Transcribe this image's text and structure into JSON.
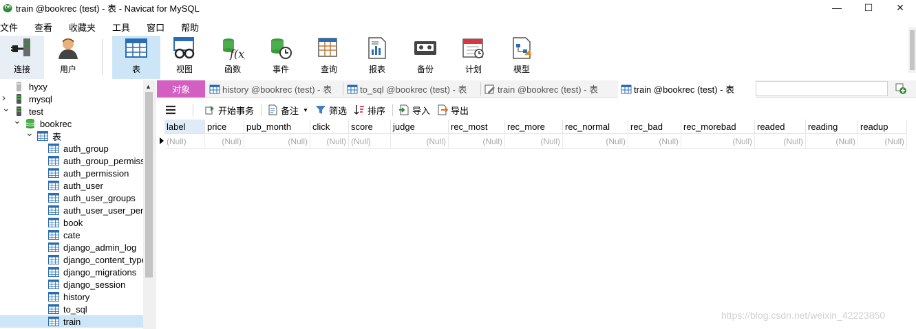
{
  "window": {
    "title": "train @bookrec (test) - 表 - Navicat for MySQL",
    "minimize": "—",
    "maximize": "☐",
    "close": "✕"
  },
  "menu": [
    "文件",
    "查看",
    "收藏夹",
    "工具",
    "窗口",
    "帮助"
  ],
  "toolbar": {
    "connect": "连接",
    "user": "用户",
    "table": "表",
    "view": "视图",
    "function": "函数",
    "event": "事件",
    "query": "查询",
    "report": "报表",
    "backup": "备份",
    "schedule": "计划",
    "model": "模型"
  },
  "sidebar": {
    "items": [
      {
        "label": "hyxy",
        "level": 0,
        "expandable": false,
        "icon": "database-gray-icon"
      },
      {
        "label": "mysql",
        "level": 0,
        "expandable": true,
        "expanded": false,
        "icon": "database-green-icon"
      },
      {
        "label": "test",
        "level": 0,
        "expandable": true,
        "expanded": true,
        "icon": "database-green-icon"
      },
      {
        "label": "bookrec",
        "level": 1,
        "expandable": true,
        "expanded": true,
        "icon": "schema-icon"
      },
      {
        "label": "表",
        "level": 2,
        "expandable": true,
        "expanded": true,
        "icon": "table-icon"
      },
      {
        "label": "auth_group",
        "level": 3,
        "icon": "table-icon"
      },
      {
        "label": "auth_group_permiss",
        "level": 3,
        "icon": "table-icon"
      },
      {
        "label": "auth_permission",
        "level": 3,
        "icon": "table-icon"
      },
      {
        "label": "auth_user",
        "level": 3,
        "icon": "table-icon"
      },
      {
        "label": "auth_user_groups",
        "level": 3,
        "icon": "table-icon"
      },
      {
        "label": "auth_user_user_pern",
        "level": 3,
        "icon": "table-icon"
      },
      {
        "label": "book",
        "level": 3,
        "icon": "table-icon"
      },
      {
        "label": "cate",
        "level": 3,
        "icon": "table-icon"
      },
      {
        "label": "django_admin_log",
        "level": 3,
        "icon": "table-icon"
      },
      {
        "label": "django_content_type",
        "level": 3,
        "icon": "table-icon"
      },
      {
        "label": "django_migrations",
        "level": 3,
        "icon": "table-icon"
      },
      {
        "label": "django_session",
        "level": 3,
        "icon": "table-icon"
      },
      {
        "label": "history",
        "level": 3,
        "icon": "table-icon"
      },
      {
        "label": "to_sql",
        "level": 3,
        "icon": "table-icon"
      },
      {
        "label": "train",
        "level": 3,
        "icon": "table-icon",
        "selected": true
      }
    ]
  },
  "tabs": {
    "objects": "对象",
    "history": "history @bookrec (test) - 表",
    "to_sql": "to_sql @bookrec (test) - 表",
    "train_design": "train @bookrec (test) - 表",
    "train_data": "train @bookrec (test) - 表"
  },
  "table_toolbar": {
    "begin_transaction": "开始事务",
    "memo": "备注",
    "filter": "筛选",
    "sort": "排序",
    "import": "导入",
    "export": "导出"
  },
  "grid": {
    "columns": [
      "label",
      "price",
      "pub_month",
      "click",
      "score",
      "judge",
      "rec_most",
      "rec_more",
      "rec_normal",
      "rec_bad",
      "rec_morebad",
      "readed",
      "reading",
      "readup"
    ],
    "row": [
      "(Null)",
      "(Null)",
      "(Null)",
      "(Null)",
      "(Null)",
      "(Null)",
      "(Null)",
      "(Null)",
      "(Null)",
      "(Null)",
      "(Null)",
      "(Null)",
      "(Null)",
      "(Null)"
    ]
  },
  "watermark": "https://blog.csdn.net/weixin_42223850",
  "colors": {
    "accent": "#cde6f7",
    "objects_tab": "#d45fc2",
    "null_text": "#a8a8a8"
  }
}
